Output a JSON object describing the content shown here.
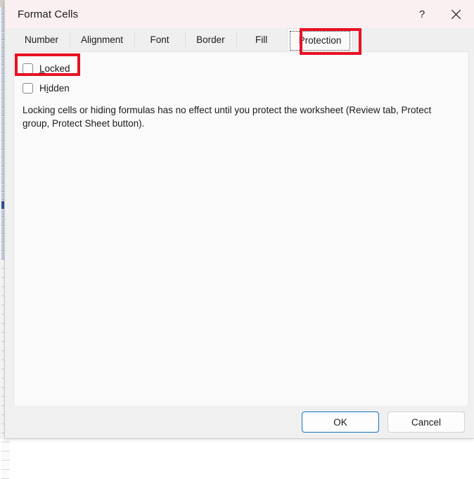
{
  "window": {
    "title": "Format Cells",
    "help_icon": "question-mark-icon",
    "help_label": "?",
    "close_icon": "close-icon"
  },
  "tabs": [
    {
      "label": "Number",
      "selected": false
    },
    {
      "label": "Alignment",
      "selected": false
    },
    {
      "label": "Font",
      "selected": false
    },
    {
      "label": "Border",
      "selected": false
    },
    {
      "label": "Fill",
      "selected": false
    },
    {
      "label": "Protection",
      "selected": true
    }
  ],
  "content": {
    "checkboxes": [
      {
        "label_before": "",
        "accel": "L",
        "label_after": "ocked",
        "checked": false
      },
      {
        "label_before": "H",
        "accel": "i",
        "label_after": "dden",
        "checked": false
      }
    ],
    "locked_label": "Locked",
    "hidden_label": "Hidden",
    "description": "Locking cells or hiding formulas has no effect until you protect the worksheet (Review tab, Protect group, Protect Sheet button)."
  },
  "footer": {
    "ok_label": "OK",
    "cancel_label": "Cancel"
  },
  "annotations": [
    {
      "name": "protection-tab-highlight",
      "color": "#e81123"
    },
    {
      "name": "locked-checkbox-highlight",
      "color": "#e81123"
    }
  ],
  "colors": {
    "titlebar": "#faeff1",
    "tabstrip": "#efefef",
    "content": "#fafafa",
    "footer": "#f0f0f0",
    "annotation": "#e81123",
    "default_button_border": "#1476c6"
  }
}
